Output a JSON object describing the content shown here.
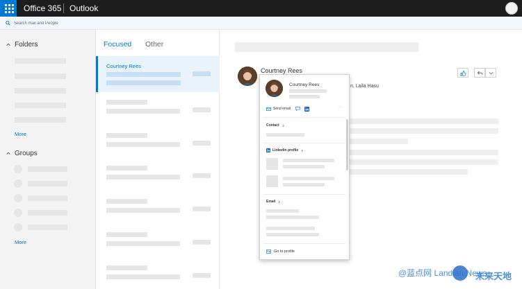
{
  "header": {
    "brand": "Office 365",
    "app": "Outlook"
  },
  "search": {
    "placeholder": "Search mail and People"
  },
  "sidebar": {
    "folders_label": "Folders",
    "folders_more": "More",
    "groups_label": "Groups",
    "groups_more": "More"
  },
  "message_list": {
    "tabs": [
      {
        "label": "Focused",
        "active": true
      },
      {
        "label": "Other",
        "active": false
      }
    ],
    "selected_sender": "Courtney Rees"
  },
  "reading": {
    "sender_name": "Courtney Rees",
    "recipients_visible": "n, Laila Hasu"
  },
  "contact_card": {
    "name": "Courtney Rees",
    "send_email_label": "Send email",
    "more_label": "···",
    "contact_section": "Contact",
    "linkedin_section": "Linkedin profile",
    "email_section": "Email",
    "go_to_profile": "Go to profile"
  },
  "watermark": {
    "text": "@蓝点网 Landian.News",
    "cn_text": "未来天地"
  },
  "colors": {
    "accent": "#0078d4",
    "topbar": "#1d1d1d",
    "linkedin": "#0a66c2"
  }
}
